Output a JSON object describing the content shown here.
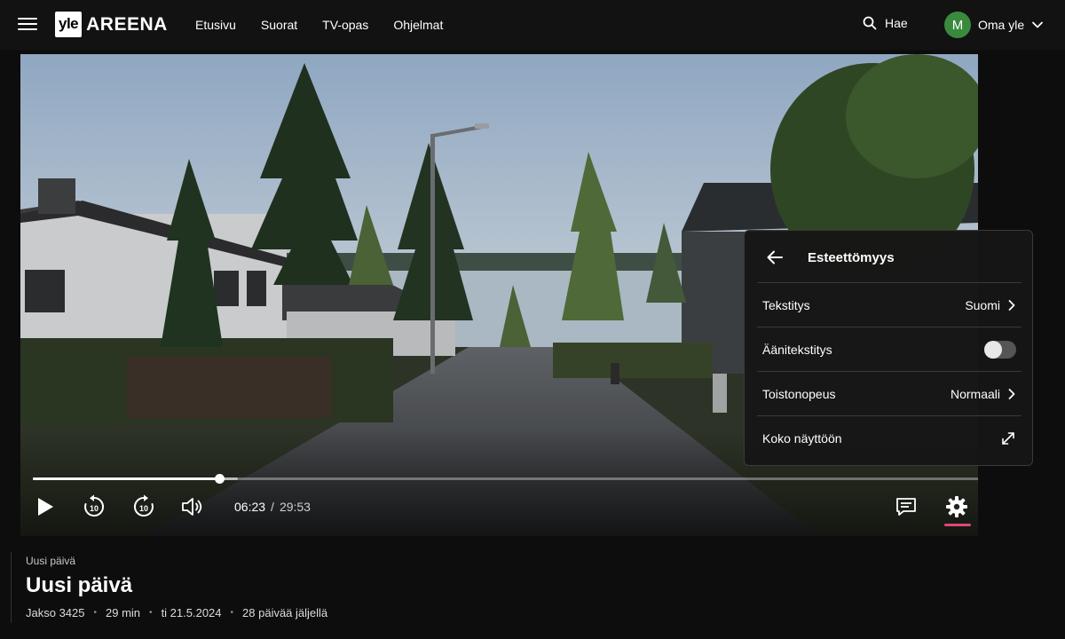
{
  "header": {
    "logo_box": "yle",
    "logo_text": "AREENA",
    "nav": [
      "Etusivu",
      "Suorat",
      "TV-opas",
      "Ohjelmat"
    ],
    "search_label": "Hae",
    "avatar_initial": "M",
    "user_label": "Oma yle"
  },
  "player": {
    "current_time": "06:23",
    "separator": "/",
    "total_time": "29:53",
    "progress_fraction": 0.186,
    "buffer_fraction": 0.205,
    "accent_color": "#e0457b"
  },
  "settings_panel": {
    "title": "Esteettömyys",
    "rows": [
      {
        "label": "Tekstitys",
        "value": "Suomi"
      },
      {
        "label": "Äänitekstitys",
        "toggle": false
      },
      {
        "label": "Toistonopeus",
        "value": "Normaali"
      },
      {
        "label": "Koko näyttöön"
      }
    ]
  },
  "info": {
    "series": "Uusi päivä",
    "title": "Uusi päivä",
    "episode": "Jakso 3425",
    "duration": "29 min",
    "date": "ti 21.5.2024",
    "remaining": "28 päivää jäljellä"
  }
}
